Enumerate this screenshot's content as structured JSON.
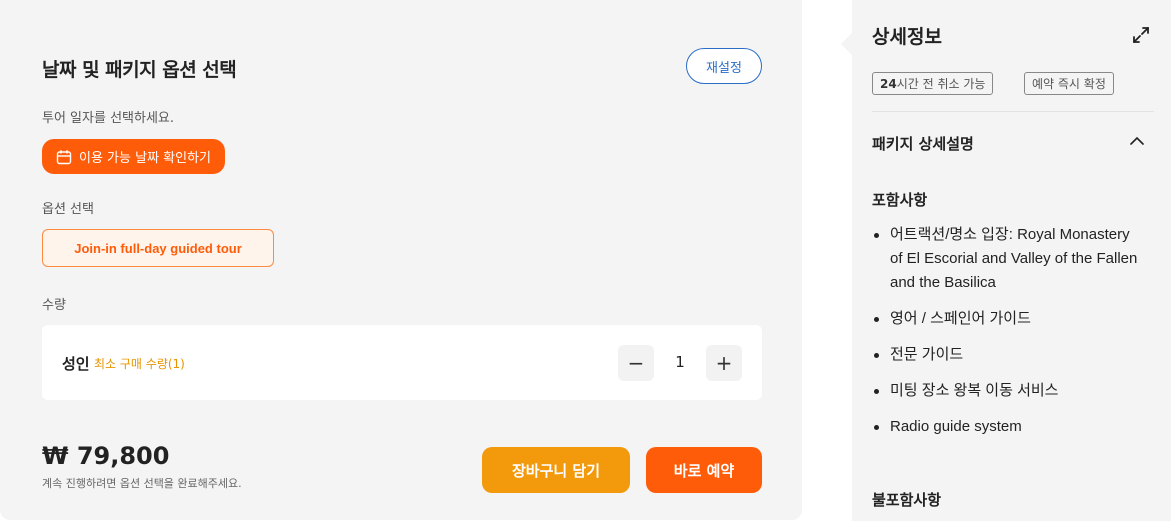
{
  "options": {
    "title": "날짜 및 패키지 옵션 선택",
    "reset_label": "재설정",
    "tour_date_label": "투어 일자를 선택하세요.",
    "date_button_label": "이용 가능 날짜 확인하기",
    "option_label": "옵션 선택",
    "option_chip": "Join-in full-day guided tour",
    "quantity_label": "수량",
    "adult_label": "성인",
    "min_purchase_note": "최소 구매 수량(1)",
    "quantity_value": "1",
    "minus_symbol": "−",
    "plus_symbol": "+",
    "price": "₩ 79,800",
    "price_note": "계속 진행하려면 옵션 선택을 완료해주세요.",
    "cart_button": "장바구니 담기",
    "book_button": "바로 예약"
  },
  "details": {
    "title": "상세정보",
    "tags": [
      {
        "strong": "24",
        "text": "시간 전 취소 가능"
      },
      {
        "strong": "",
        "text": "예약 즉시 확정"
      }
    ],
    "package_description_title": "패키지 상세설명",
    "includes_title": "포함사항",
    "includes": [
      "어트랙션/명소 입장: Royal Monastery of El Escorial and Valley of the Fallen and the Basilica",
      "영어 / 스페인어 가이드",
      "전문 가이드",
      "미팅 장소 왕복 이동 서비스",
      "Radio guide system"
    ],
    "excludes_title": "불포함사항"
  },
  "colors": {
    "accent_orange": "#ff5c0a",
    "cart_orange": "#f29a0c",
    "link_blue": "#2a6dc7",
    "panel_bg": "#f4f4f4"
  },
  "icons": [
    "calendar-icon",
    "expand-icon",
    "chevron-up-icon",
    "minus-icon",
    "plus-icon"
  ]
}
